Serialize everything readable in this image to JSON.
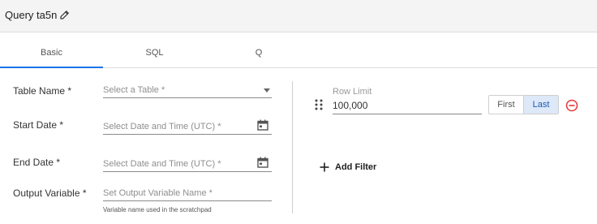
{
  "header": {
    "title": "Query ta5n",
    "edit_icon": "pencil-icon"
  },
  "tabs": [
    {
      "label": "Basic",
      "active": true
    },
    {
      "label": "SQL",
      "active": false
    },
    {
      "label": "Q",
      "active": false
    }
  ],
  "form": {
    "table_name": {
      "label": "Table Name *",
      "placeholder": "Select a Table *"
    },
    "start_date": {
      "label": "Start Date *",
      "placeholder": "Select Date and Time (UTC) *"
    },
    "end_date": {
      "label": "End Date *",
      "placeholder": "Select Date and Time (UTC) *"
    },
    "output_variable": {
      "label": "Output Variable *",
      "placeholder": "Set Output Variable Name *",
      "helper": "Variable name used in the scratchpad"
    }
  },
  "row_limit": {
    "label": "Row Limit",
    "value": "100,000",
    "options": [
      "First",
      "Last"
    ],
    "selected": "Last"
  },
  "add_filter": {
    "label": "Add Filter"
  },
  "colors": {
    "accent": "#1a73e8",
    "remove": "#e53935",
    "selected_bg": "#dde8f8"
  }
}
